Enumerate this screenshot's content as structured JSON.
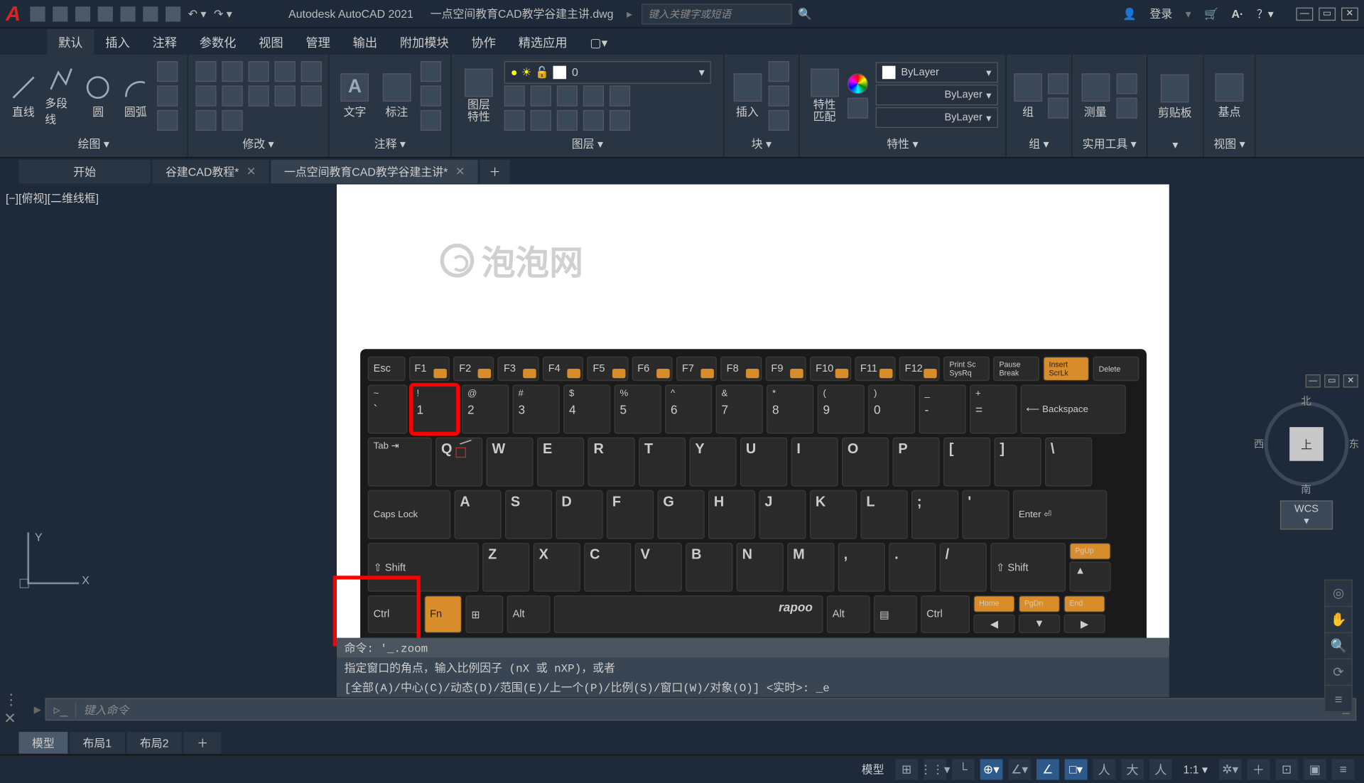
{
  "title": {
    "app": "Autodesk AutoCAD 2021",
    "file": "一点空间教育CAD教学谷建主讲.dwg",
    "search_placeholder": "键入关键字或短语",
    "login": "登录"
  },
  "ribbon_tabs": [
    "默认",
    "插入",
    "注释",
    "参数化",
    "视图",
    "管理",
    "输出",
    "附加模块",
    "协作",
    "精选应用"
  ],
  "ribbon_panels": {
    "draw": {
      "title": "绘图",
      "line": "直线",
      "pline": "多段线",
      "circle": "圆",
      "arc": "圆弧"
    },
    "modify": {
      "title": "修改"
    },
    "annot": {
      "title": "注释",
      "text": "文字",
      "dim": "标注"
    },
    "layers": {
      "title": "图层",
      "btn": "图层\n特性",
      "current": "0"
    },
    "block": {
      "title": "块",
      "insert": "插入"
    },
    "props": {
      "title": "特性",
      "btn": "特性\n匹配",
      "bylayer": "ByLayer"
    },
    "group": {
      "title": "组",
      "btn": "组"
    },
    "util": {
      "title": "实用工具",
      "measure": "测量"
    },
    "clip": {
      "title": "剪贴板"
    },
    "base": "基点",
    "view": {
      "title": "视图"
    }
  },
  "file_tabs": {
    "start": "开始",
    "t1": "谷建CAD教程*",
    "t2": "一点空间教育CAD教学谷建主讲*"
  },
  "viewport_label": "[−][俯视][二维线框]",
  "watermark": "泡泡网",
  "viewcube": {
    "top": "上",
    "n": "北",
    "s": "南",
    "e": "东",
    "w": "西",
    "wcs": "WCS"
  },
  "ucs": {
    "x": "X",
    "y": "Y"
  },
  "keyboard": {
    "row_fn": [
      "Esc",
      "F1",
      "F2",
      "F3",
      "F4",
      "F5",
      "F6",
      "F7",
      "F8",
      "F9",
      "F10",
      "F11",
      "F12",
      "Print Sc\nSysRq",
      "Pause\nBreak",
      "Insert\nScrLk",
      "Delete"
    ],
    "row_num_top": [
      "~",
      "!",
      "@",
      "#",
      "$",
      "%",
      "^",
      "&",
      "*",
      "(",
      ")",
      "_",
      "+"
    ],
    "row_num_bot": [
      "`",
      "1",
      "2",
      "3",
      "4",
      "5",
      "6",
      "7",
      "8",
      "9",
      "0",
      "-",
      "="
    ],
    "backspace": "Backspace",
    "tab": "Tab",
    "row_q": [
      "Q",
      "W",
      "E",
      "R",
      "T",
      "Y",
      "U",
      "I",
      "O",
      "P",
      "[",
      "]",
      "\\"
    ],
    "caps": "Caps Lock",
    "row_a": [
      "A",
      "S",
      "D",
      "F",
      "G",
      "H",
      "J",
      "K",
      "L",
      ";",
      "'"
    ],
    "enter": "Enter",
    "shift": "Shift",
    "row_z": [
      "Z",
      "X",
      "C",
      "V",
      "B",
      "N",
      "M",
      ",",
      ".",
      "/"
    ],
    "ctrl": "Ctrl",
    "fn": "Fn",
    "alt": "Alt",
    "brand": "rapoo",
    "bottom_small": [
      "PgUp",
      "PgDn",
      "Home",
      "End"
    ]
  },
  "cmdhist": {
    "l1": "命令:  '_.zoom",
    "l2": "指定窗口的角点，输入比例因子 (nX 或 nXP)，或者",
    "l3": "[全部(A)/中心(C)/动态(D)/范围(E)/上一个(P)/比例(S)/窗口(W)/对象(O)] <实时>:  _e"
  },
  "cmd_placeholder": "键入命令",
  "layout_tabs": [
    "模型",
    "布局1",
    "布局2"
  ],
  "status": {
    "model": "模型",
    "scale": "1:1"
  }
}
